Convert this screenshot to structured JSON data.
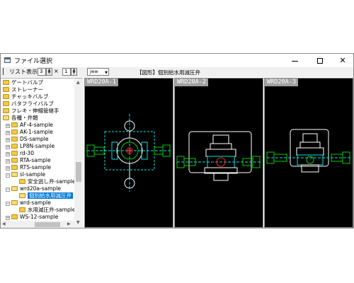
{
  "window": {
    "title": "ファイル選択"
  },
  "toolbar": {
    "list_label": "リスト表示",
    "cols": "3",
    "times": "×",
    "rows": "1",
    "format": "jww",
    "current_folder": "【図形】個別給水用減圧弁"
  },
  "tree": {
    "items": [
      {
        "label": "ゲートバルブ"
      },
      {
        "label": "ストレーナー"
      },
      {
        "label": "チャッキバルブ"
      },
      {
        "label": "バタフライバルブ"
      },
      {
        "label": "フレキ・伸縮管継手"
      },
      {
        "label": "各種・弁類"
      },
      {
        "label": "AF-4-sample"
      },
      {
        "label": "AK-1-sample"
      },
      {
        "label": "DS-sample"
      },
      {
        "label": "LP8N-sample"
      },
      {
        "label": "rd-30"
      },
      {
        "label": "RTA-sample"
      },
      {
        "label": "RTS-sample"
      },
      {
        "label": "sl-sample"
      },
      {
        "label": "安全逃し弁-sample"
      },
      {
        "label": "wrd20a-sample"
      },
      {
        "label": "個別給水用減圧弁"
      },
      {
        "label": "wrd-sample"
      },
      {
        "label": "水用減圧弁-sample"
      },
      {
        "label": "WS-12-sample"
      }
    ]
  },
  "panels": [
    {
      "label": "WRD20A-1"
    },
    {
      "label": "WRD20A-2"
    },
    {
      "label": "WRD20A-3"
    }
  ],
  "colors": {
    "cad_background": "#000000",
    "cad_cyan": "#00e5e5",
    "cad_green": "#00d000",
    "cad_white": "#ffffff",
    "cad_red": "#ff2020",
    "selection": "#0078d7"
  }
}
